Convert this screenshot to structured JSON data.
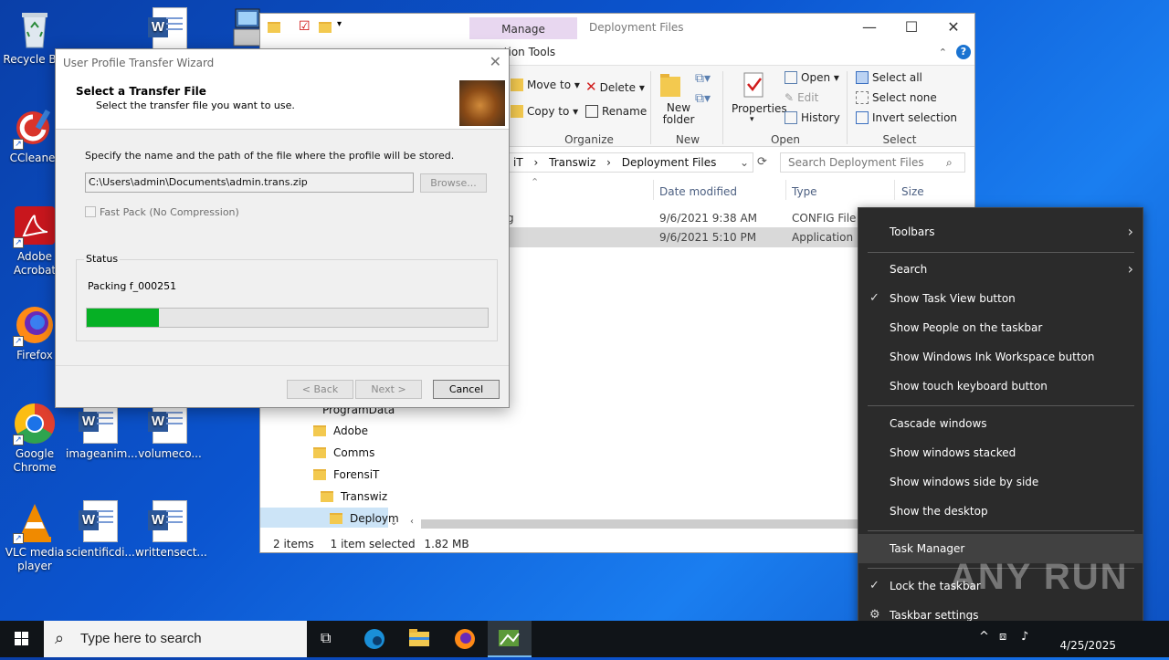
{
  "desktop": {
    "icons": [
      {
        "label": "Recycle Bin",
        "icon": "recycle-bin-icon"
      },
      {
        "label": "CCleaner",
        "icon": "ccleaner-icon"
      },
      {
        "label": "Adobe Acrobat",
        "icon": "adobe-acrobat-icon"
      },
      {
        "label": "Firefox",
        "icon": "firefox-icon"
      },
      {
        "label": "Google Chrome",
        "icon": "chrome-icon"
      },
      {
        "label": "VLC media player",
        "icon": "vlc-icon"
      },
      {
        "label": "imageanim...",
        "icon": "word-doc-icon"
      },
      {
        "label": "volumeco...",
        "icon": "word-doc-icon"
      },
      {
        "label": "scientificdi...",
        "icon": "word-doc-icon"
      },
      {
        "label": "writtensect...",
        "icon": "word-doc-icon"
      }
    ]
  },
  "explorer": {
    "manage_tab": "Manage",
    "app_tools_tab": "cation Tools",
    "title": "Deployment Files",
    "ribbon": {
      "move_to": "Move to",
      "copy_to": "Copy to",
      "delete": "Delete",
      "rename": "Rename",
      "new_folder": "New folder",
      "properties": "Properties",
      "open": "Open",
      "edit": "Edit",
      "history": "History",
      "select_all": "Select all",
      "select_none": "Select none",
      "invert_selection": "Invert selection",
      "groups": {
        "organize": "Organize",
        "new": "New",
        "open": "Open",
        "select": "Select"
      }
    },
    "address": {
      "segments": [
        "iT",
        "Transwiz",
        "Deployment Files"
      ]
    },
    "search_placeholder": "Search Deployment Files",
    "columns": {
      "date_modified": "Date modified",
      "type": "Type",
      "size": "Size"
    },
    "files": [
      {
        "name_fragment": "g",
        "date": "9/6/2021 9:38 AM",
        "type": "CONFIG File"
      },
      {
        "name_fragment": "",
        "date": "9/6/2021 5:10 PM",
        "type": "Application"
      }
    ],
    "tree": [
      "ProgramData",
      "Adobe",
      "Comms",
      "ForensiT",
      "Transwiz",
      "Deploym"
    ],
    "status": {
      "items": "2 items",
      "selected": "1 item selected",
      "size": "1.82 MB"
    }
  },
  "wizard": {
    "title": "User Profile Transfer Wizard",
    "heading": "Select a Transfer File",
    "subheading": "Select the transfer file you want to use.",
    "instruction": "Specify the name and the path of the file where the profile will be stored.",
    "path_value": "C:\\Users\\admin\\Documents\\admin.trans.zip",
    "browse": "Browse...",
    "fast_pack": "Fast Pack (No Compression)",
    "status_label": "Status",
    "packing_text": "Packing f_000251",
    "progress": 0.18,
    "back": "< Back",
    "next": "Next >",
    "cancel": "Cancel"
  },
  "context_menu": {
    "toolbars": "Toolbars",
    "search": "Search",
    "show_task_view": "Show Task View button",
    "show_people": "Show People on the taskbar",
    "show_ink": "Show Windows Ink Workspace button",
    "show_touch_keyboard": "Show touch keyboard button",
    "cascade": "Cascade windows",
    "stacked": "Show windows stacked",
    "side_by_side": "Show windows side by side",
    "show_desktop": "Show the desktop",
    "task_manager": "Task Manager",
    "lock_taskbar": "Lock the taskbar",
    "taskbar_settings": "Taskbar settings"
  },
  "taskbar": {
    "search_placeholder": "Type here to search",
    "date": "4/25/2025"
  },
  "watermark": "ANY RUN"
}
